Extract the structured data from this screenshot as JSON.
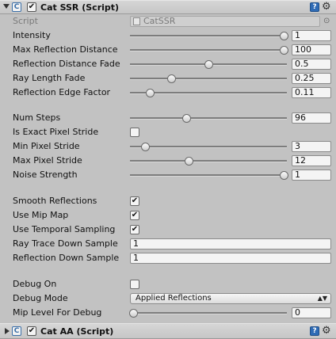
{
  "component1": {
    "title": "Cat SSR (Script)",
    "help_glyph": "?",
    "gear_glyph": "⚙",
    "script": {
      "label": "Script",
      "value": "CatSSR",
      "picker_glyph": "⊙"
    }
  },
  "rows": {
    "intensity": {
      "label": "Intensity",
      "value": "1",
      "level": 1.0
    },
    "max_reflection_distance": {
      "label": "Max Reflection Distance",
      "value": "100",
      "level": 1.0
    },
    "reflection_distance_fade": {
      "label": "Reflection Distance Fade",
      "value": "0.5",
      "level": 0.5
    },
    "ray_length_fade": {
      "label": "Ray Length Fade",
      "value": "0.25",
      "level": 0.25
    },
    "reflection_edge_factor": {
      "label": "Reflection Edge Factor",
      "value": "0.11",
      "level": 0.11
    },
    "num_steps": {
      "label": "Num Steps",
      "value": "96",
      "level": 0.35
    },
    "is_exact_pixel_stride": {
      "label": "Is Exact Pixel Stride",
      "checked": false
    },
    "min_pixel_stride": {
      "label": "Min Pixel Stride",
      "value": "3",
      "level": 0.08
    },
    "max_pixel_stride": {
      "label": "Max Pixel Stride",
      "value": "12",
      "level": 0.37
    },
    "noise_strength": {
      "label": "Noise Strength",
      "value": "1",
      "level": 1.0
    },
    "smooth_reflections": {
      "label": "Smooth Reflections",
      "checked": true
    },
    "use_mip_map": {
      "label": "Use Mip Map",
      "checked": true
    },
    "use_temporal_sampling": {
      "label": "Use Temporal Sampling",
      "checked": true
    },
    "ray_trace_down_sample": {
      "label": "Ray Trace Down Sample",
      "value": "1"
    },
    "reflection_down_sample": {
      "label": "Reflection Down Sample",
      "value": "1"
    },
    "debug_on": {
      "label": "Debug On",
      "checked": false
    },
    "debug_mode": {
      "label": "Debug Mode",
      "value": "Applied Reflections",
      "arrow_glyph": "▲▼"
    },
    "mip_level_for_debug": {
      "label": "Mip Level For Debug",
      "value": "0",
      "level": 0.0
    }
  },
  "component2": {
    "title": "Cat AA (Script)",
    "help_glyph": "?",
    "gear_glyph": "⚙"
  },
  "icons": {
    "script_icon_glyph": "C",
    "check_glyph": "✔"
  },
  "colors": {
    "background": "#c2c2c2",
    "field_bg": "#f4f4f4",
    "help_blue": "#2f6bb5",
    "script_icon_blue": "#3b6fa8"
  }
}
